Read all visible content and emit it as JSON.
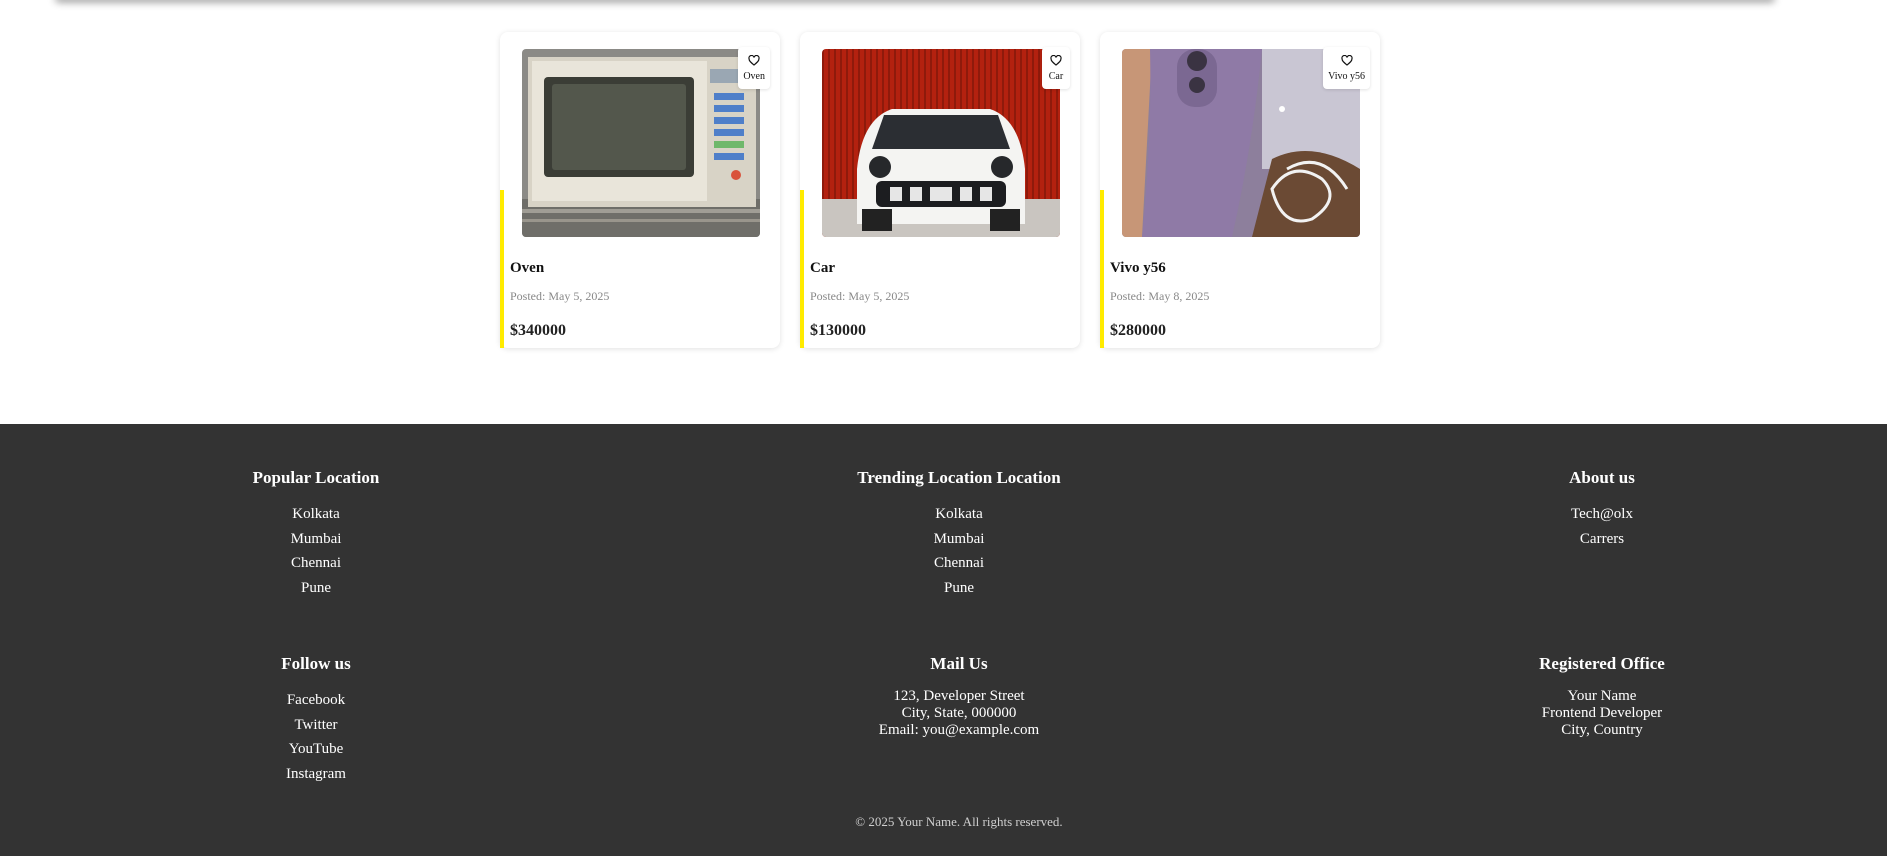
{
  "products": [
    {
      "title": "Oven",
      "tag": "Oven",
      "posted": "Posted: May 5, 2025",
      "price": "$340000",
      "image": "microwave-oven-photo"
    },
    {
      "title": "Car",
      "tag": "Car",
      "posted": "Posted: May 5, 2025",
      "price": "$130000",
      "image": "white-car-photo"
    },
    {
      "title": "Vivo y56",
      "tag": "Vivo y56",
      "posted": "Posted: May 8, 2025",
      "price": "$280000",
      "image": "purple-phone-photo"
    }
  ],
  "footer": {
    "popular": {
      "heading": "Popular Location",
      "items": [
        "Kolkata",
        "Mumbai",
        "Chennai",
        "Pune"
      ]
    },
    "trending": {
      "heading": "Trending Location Location",
      "items": [
        "Kolkata",
        "Mumbai",
        "Chennai",
        "Pune"
      ]
    },
    "about": {
      "heading": "About us",
      "items": [
        "Tech@olx",
        "Carrers"
      ]
    },
    "follow": {
      "heading": "Follow us",
      "items": [
        "Facebook",
        "Twitter",
        "YouTube",
        "Instagram"
      ]
    },
    "mail": {
      "heading": "Mail Us",
      "lines": [
        "123, Developer Street",
        "City, State, 000000",
        "Email: you@example.com"
      ]
    },
    "office": {
      "heading": "Registered Office",
      "lines": [
        "Your Name",
        "Frontend Developer",
        "City, Country"
      ]
    },
    "copyright": "© 2025 Your Name. All rights reserved."
  },
  "colors": {
    "accent": "#ffeb00",
    "footer_bg": "#333333",
    "posted_text": "#888888"
  },
  "icons": {
    "favorite": "heart-icon"
  }
}
